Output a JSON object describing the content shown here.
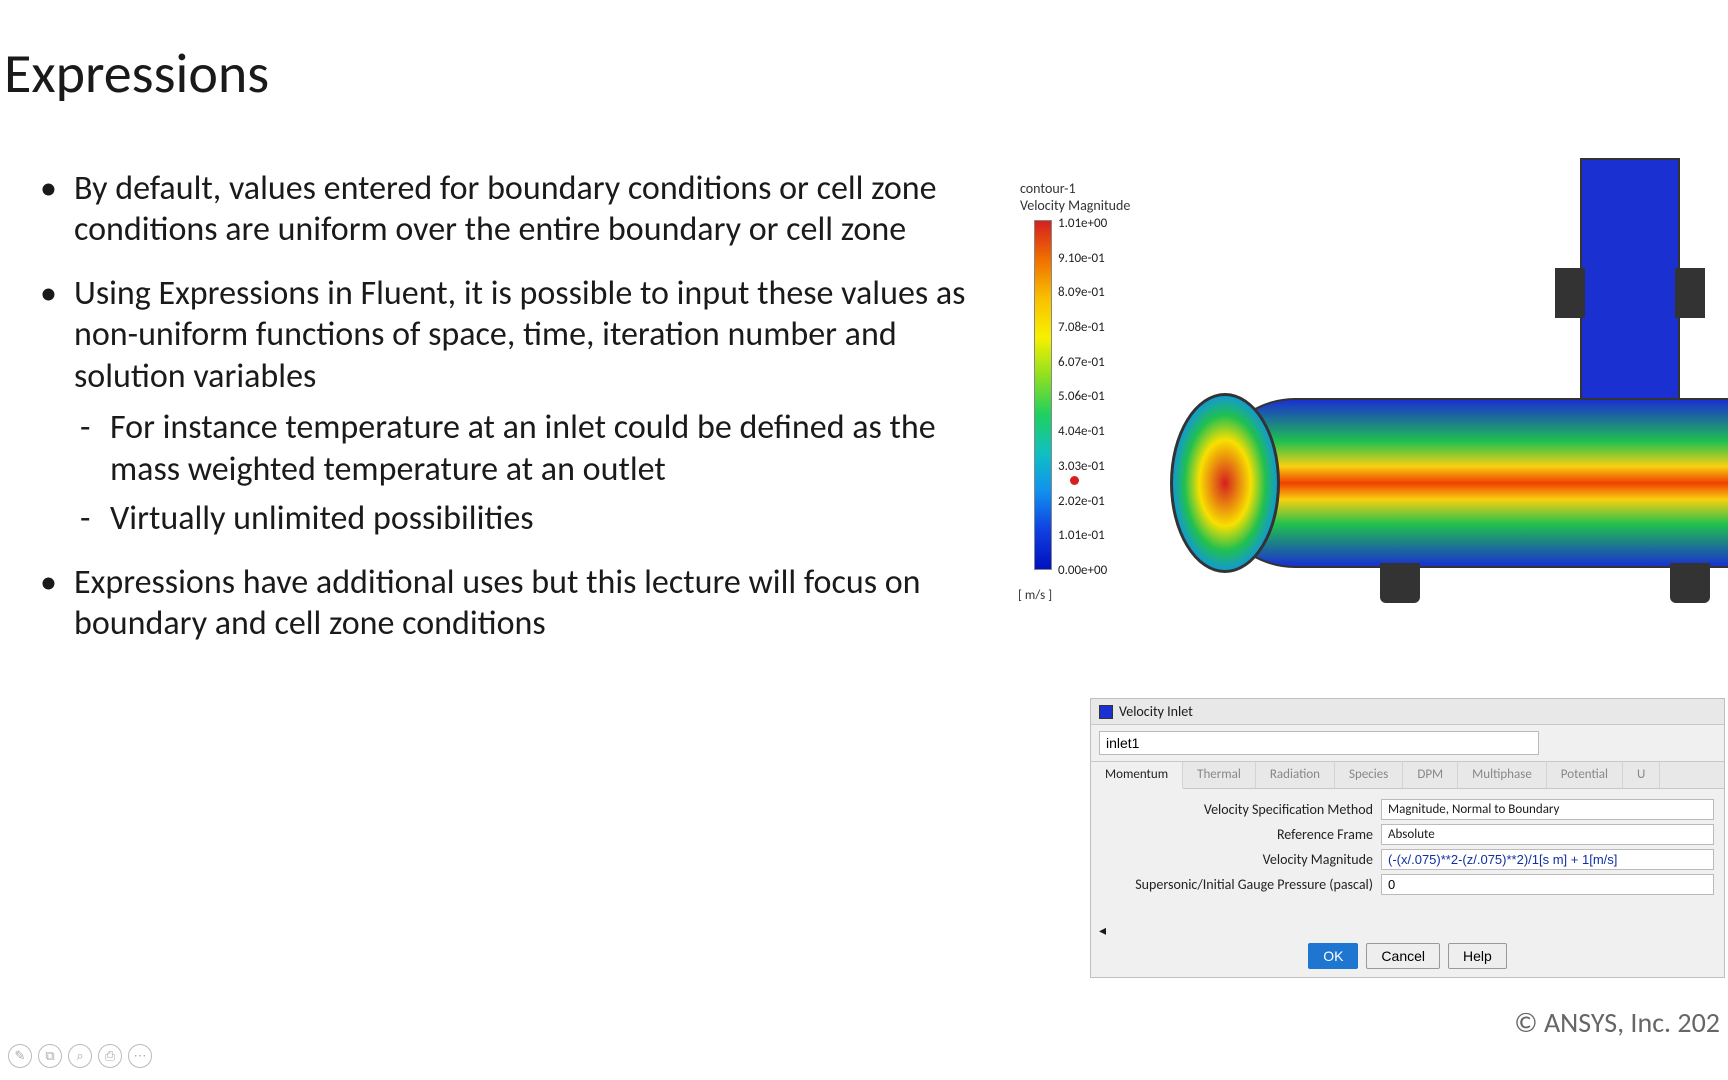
{
  "title": "Expressions",
  "bullets": {
    "b1": "By default, values entered for boundary conditions or cell zone conditions are uniform over the entire boundary or cell zone",
    "b2": "Using Expressions in Fluent, it is possible to input these values as non-uniform functions of space, time, iteration number and solution variables",
    "b2_s1": "For instance temperature at an inlet could be defined as the mass weighted temperature at an outlet",
    "b2_s2": "Virtually unlimited possibilities",
    "b3": "Expressions have additional uses but this lecture will focus on boundary and cell zone conditions"
  },
  "contour": {
    "name": "contour-1",
    "var": "Velocity Magnitude",
    "unit": "[ m/s ]",
    "ticks": [
      "1.01e+00",
      "9.10e-01",
      "8.09e-01",
      "7.08e-01",
      "6.07e-01",
      "5.06e-01",
      "4.04e-01",
      "3.03e-01",
      "2.02e-01",
      "1.01e-01",
      "0.00e+00"
    ]
  },
  "dialog": {
    "title": "Velocity Inlet",
    "zone_name": "inlet1",
    "tabs": [
      "Momentum",
      "Thermal",
      "Radiation",
      "Species",
      "DPM",
      "Multiphase",
      "Potential",
      "U"
    ],
    "labels": {
      "spec_method": "Velocity Specification Method",
      "ref_frame": "Reference Frame",
      "vel_mag": "Velocity Magnitude",
      "sup_press": "Supersonic/Initial Gauge Pressure (pascal)"
    },
    "values": {
      "spec_method": "Magnitude, Normal to Boundary",
      "ref_frame": "Absolute",
      "vel_mag_expr": "(-(x/.075)**2-(z/.075)**2)/1[s m] + 1[m/s]",
      "sup_press": "0"
    },
    "buttons": {
      "ok": "OK",
      "cancel": "Cancel",
      "help": "Help"
    }
  },
  "copyright": "© ANSYS, Inc. 202",
  "footer_icons": [
    "pen-icon",
    "copy-icon",
    "search-icon",
    "print-icon",
    "more-icon"
  ]
}
